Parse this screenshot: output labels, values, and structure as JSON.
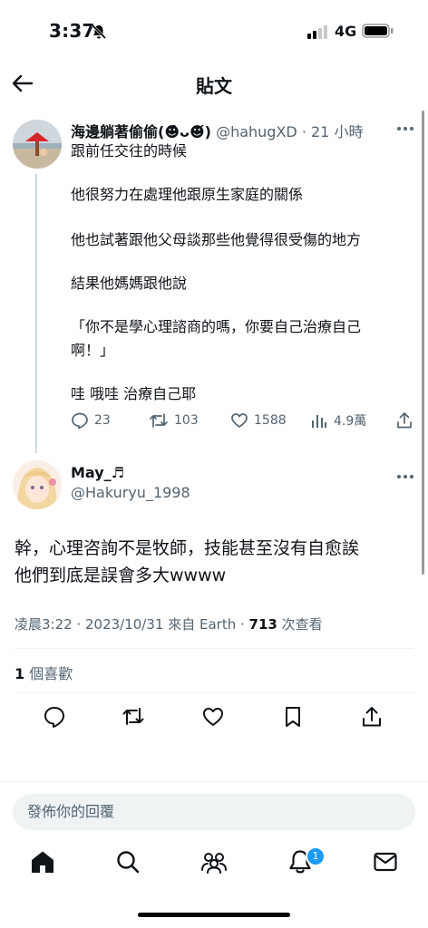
{
  "status": {
    "time": "3:37",
    "network": "4G"
  },
  "header": {
    "title": "貼文"
  },
  "parent_post": {
    "author_name": "海邊躺著偷偷(☻̀ᴗ☻́)",
    "handle_time": "@hahugXD · 21 小時",
    "lines": [
      "跟前任交往的時候",
      "他很努力在處理他跟原生家庭的關係",
      "他也試著跟他父母談那些他覺得很受傷的地方",
      "結果他媽媽跟他說",
      "「你不是學心理諮商的嗎，你要自己治療自己",
      "啊！」",
      "哇 哦哇 治療自己耶"
    ],
    "replies": "23",
    "reposts": "103",
    "likes": "1588",
    "views": "4.9萬"
  },
  "reply_post": {
    "author_name": "May_♬",
    "handle": "@Hakuryu_1998",
    "body_line1": "幹，心理咨詢不是牧師，技能甚至沒有自愈誒",
    "body_line2": "他們到底是誤會多大wwww",
    "timestamp": "凌晨3:22 · 2023/10/31 來自 Earth · ",
    "view_count": "713",
    "view_label": " 次查看",
    "like_count": "1",
    "like_label": " 個喜歡"
  },
  "reply_bar": {
    "placeholder": "發佈你的回覆"
  },
  "tabbar": {
    "notification_badge": "1"
  },
  "colors": {
    "accent": "#1d9bf0",
    "text": "#0f1419",
    "muted": "#536471",
    "divider": "#eff3f4"
  }
}
